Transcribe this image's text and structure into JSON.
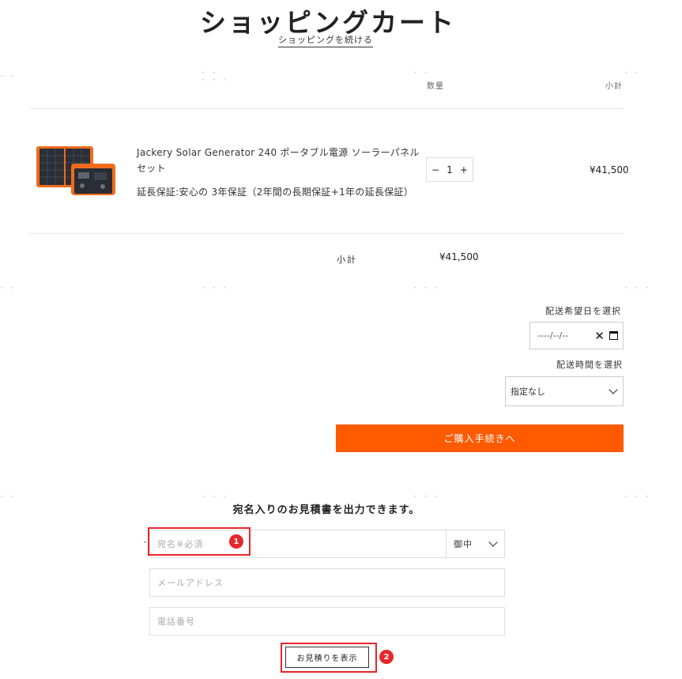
{
  "header": {
    "title": "ショッピングカート",
    "continue_link": "ショッピングを続ける"
  },
  "columns": {
    "quantity": "数量",
    "subtotal": "小計"
  },
  "cart": {
    "item": {
      "name": "Jackery Solar Generator 240 ポータブル電源 ソーラーパネル セット",
      "warranty": "延長保証:安心の 3年保証（2年間の長期保証+1年の延長保証）",
      "quantity": "1",
      "minus": "−",
      "plus": "+",
      "price": "¥41,500"
    },
    "subtotal_label": "小計",
    "subtotal_value": "¥41,500"
  },
  "delivery": {
    "date_label": "配送希望日を選択",
    "date_value": "----/--/--",
    "clear_symbol": "✕",
    "time_label": "配送時間を選択",
    "time_value": "指定なし"
  },
  "checkout_button": "ご購入手続きへ",
  "quote": {
    "heading": "宛名入りのお見積書を出力できます。",
    "name_placeholder": "宛名※必須",
    "honorific_value": "御中",
    "email_placeholder": "メールアドレス",
    "phone_placeholder": "電話番号",
    "button": "お見積りを表示"
  },
  "annotations": {
    "badge_1": "1",
    "badge_2": "2",
    "color": "#e8262b"
  },
  "colors": {
    "accent": "#ff5a00",
    "text": "#222222",
    "divider": "#e6e6e6"
  },
  "icons": {
    "calendar": "calendar-icon",
    "clear": "clear-icon",
    "dropdown": "chevron-down-icon"
  }
}
